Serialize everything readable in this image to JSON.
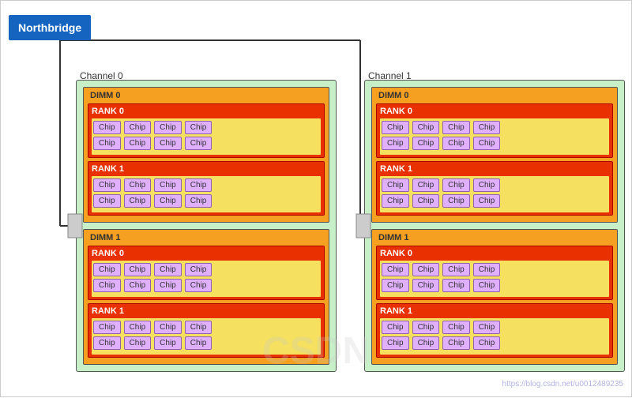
{
  "northbridge": {
    "label": "Northbridge"
  },
  "channels": [
    {
      "id": "channel-0",
      "label": "Channel 0",
      "dimms": [
        {
          "id": "dimm-0-0",
          "label": "DIMM 0",
          "ranks": [
            {
              "id": "rank-0-0-0",
              "label": "RANK 0",
              "rows": [
                [
                  "Chip",
                  "Chip",
                  "Chip",
                  "Chip"
                ],
                [
                  "Chip",
                  "Chip",
                  "Chip",
                  "Chip"
                ]
              ]
            },
            {
              "id": "rank-0-0-1",
              "label": "RANK 1",
              "rows": [
                [
                  "Chip",
                  "Chip",
                  "Chip",
                  "Chip"
                ],
                [
                  "Chip",
                  "Chip",
                  "Chip",
                  "Chip"
                ]
              ]
            }
          ]
        },
        {
          "id": "dimm-0-1",
          "label": "DIMM 1",
          "ranks": [
            {
              "id": "rank-0-1-0",
              "label": "RANK 0",
              "rows": [
                [
                  "Chip",
                  "Chip",
                  "Chip",
                  "Chip"
                ],
                [
                  "Chip",
                  "Chip",
                  "Chip",
                  "Chip"
                ]
              ]
            },
            {
              "id": "rank-0-1-1",
              "label": "RANK 1",
              "rows": [
                [
                  "Chip",
                  "Chip",
                  "Chip",
                  "Chip"
                ],
                [
                  "Chip",
                  "Chip",
                  "Chip",
                  "Chip"
                ]
              ]
            }
          ]
        }
      ]
    },
    {
      "id": "channel-1",
      "label": "Channel 1",
      "dimms": [
        {
          "id": "dimm-1-0",
          "label": "DIMM 0",
          "ranks": [
            {
              "id": "rank-1-0-0",
              "label": "RANK 0",
              "rows": [
                [
                  "Chip",
                  "Chip",
                  "Chip",
                  "Chip"
                ],
                [
                  "Chip",
                  "Chip",
                  "Chip",
                  "Chip"
                ]
              ]
            },
            {
              "id": "rank-1-0-1",
              "label": "RANK 1",
              "rows": [
                [
                  "Chip",
                  "Chip",
                  "Chip",
                  "Chip"
                ],
                [
                  "Chip",
                  "Chip",
                  "Chip",
                  "Chip"
                ]
              ]
            }
          ]
        },
        {
          "id": "dimm-1-1",
          "label": "DIMM 1",
          "ranks": [
            {
              "id": "rank-1-1-0",
              "label": "RANK 0",
              "rows": [
                [
                  "Chip",
                  "Chip",
                  "Chip",
                  "Chip"
                ],
                [
                  "Chip",
                  "Chip",
                  "Chip",
                  "Chip"
                ]
              ]
            },
            {
              "id": "rank-1-1-1",
              "label": "RANK 1",
              "rows": [
                [
                  "Chip",
                  "Chip",
                  "Chip",
                  "Chip"
                ],
                [
                  "Chip",
                  "Chip",
                  "Chip",
                  "Chip"
                ]
              ]
            }
          ]
        }
      ]
    }
  ],
  "watermark": "https://blog.csdn.net/u0012489235"
}
